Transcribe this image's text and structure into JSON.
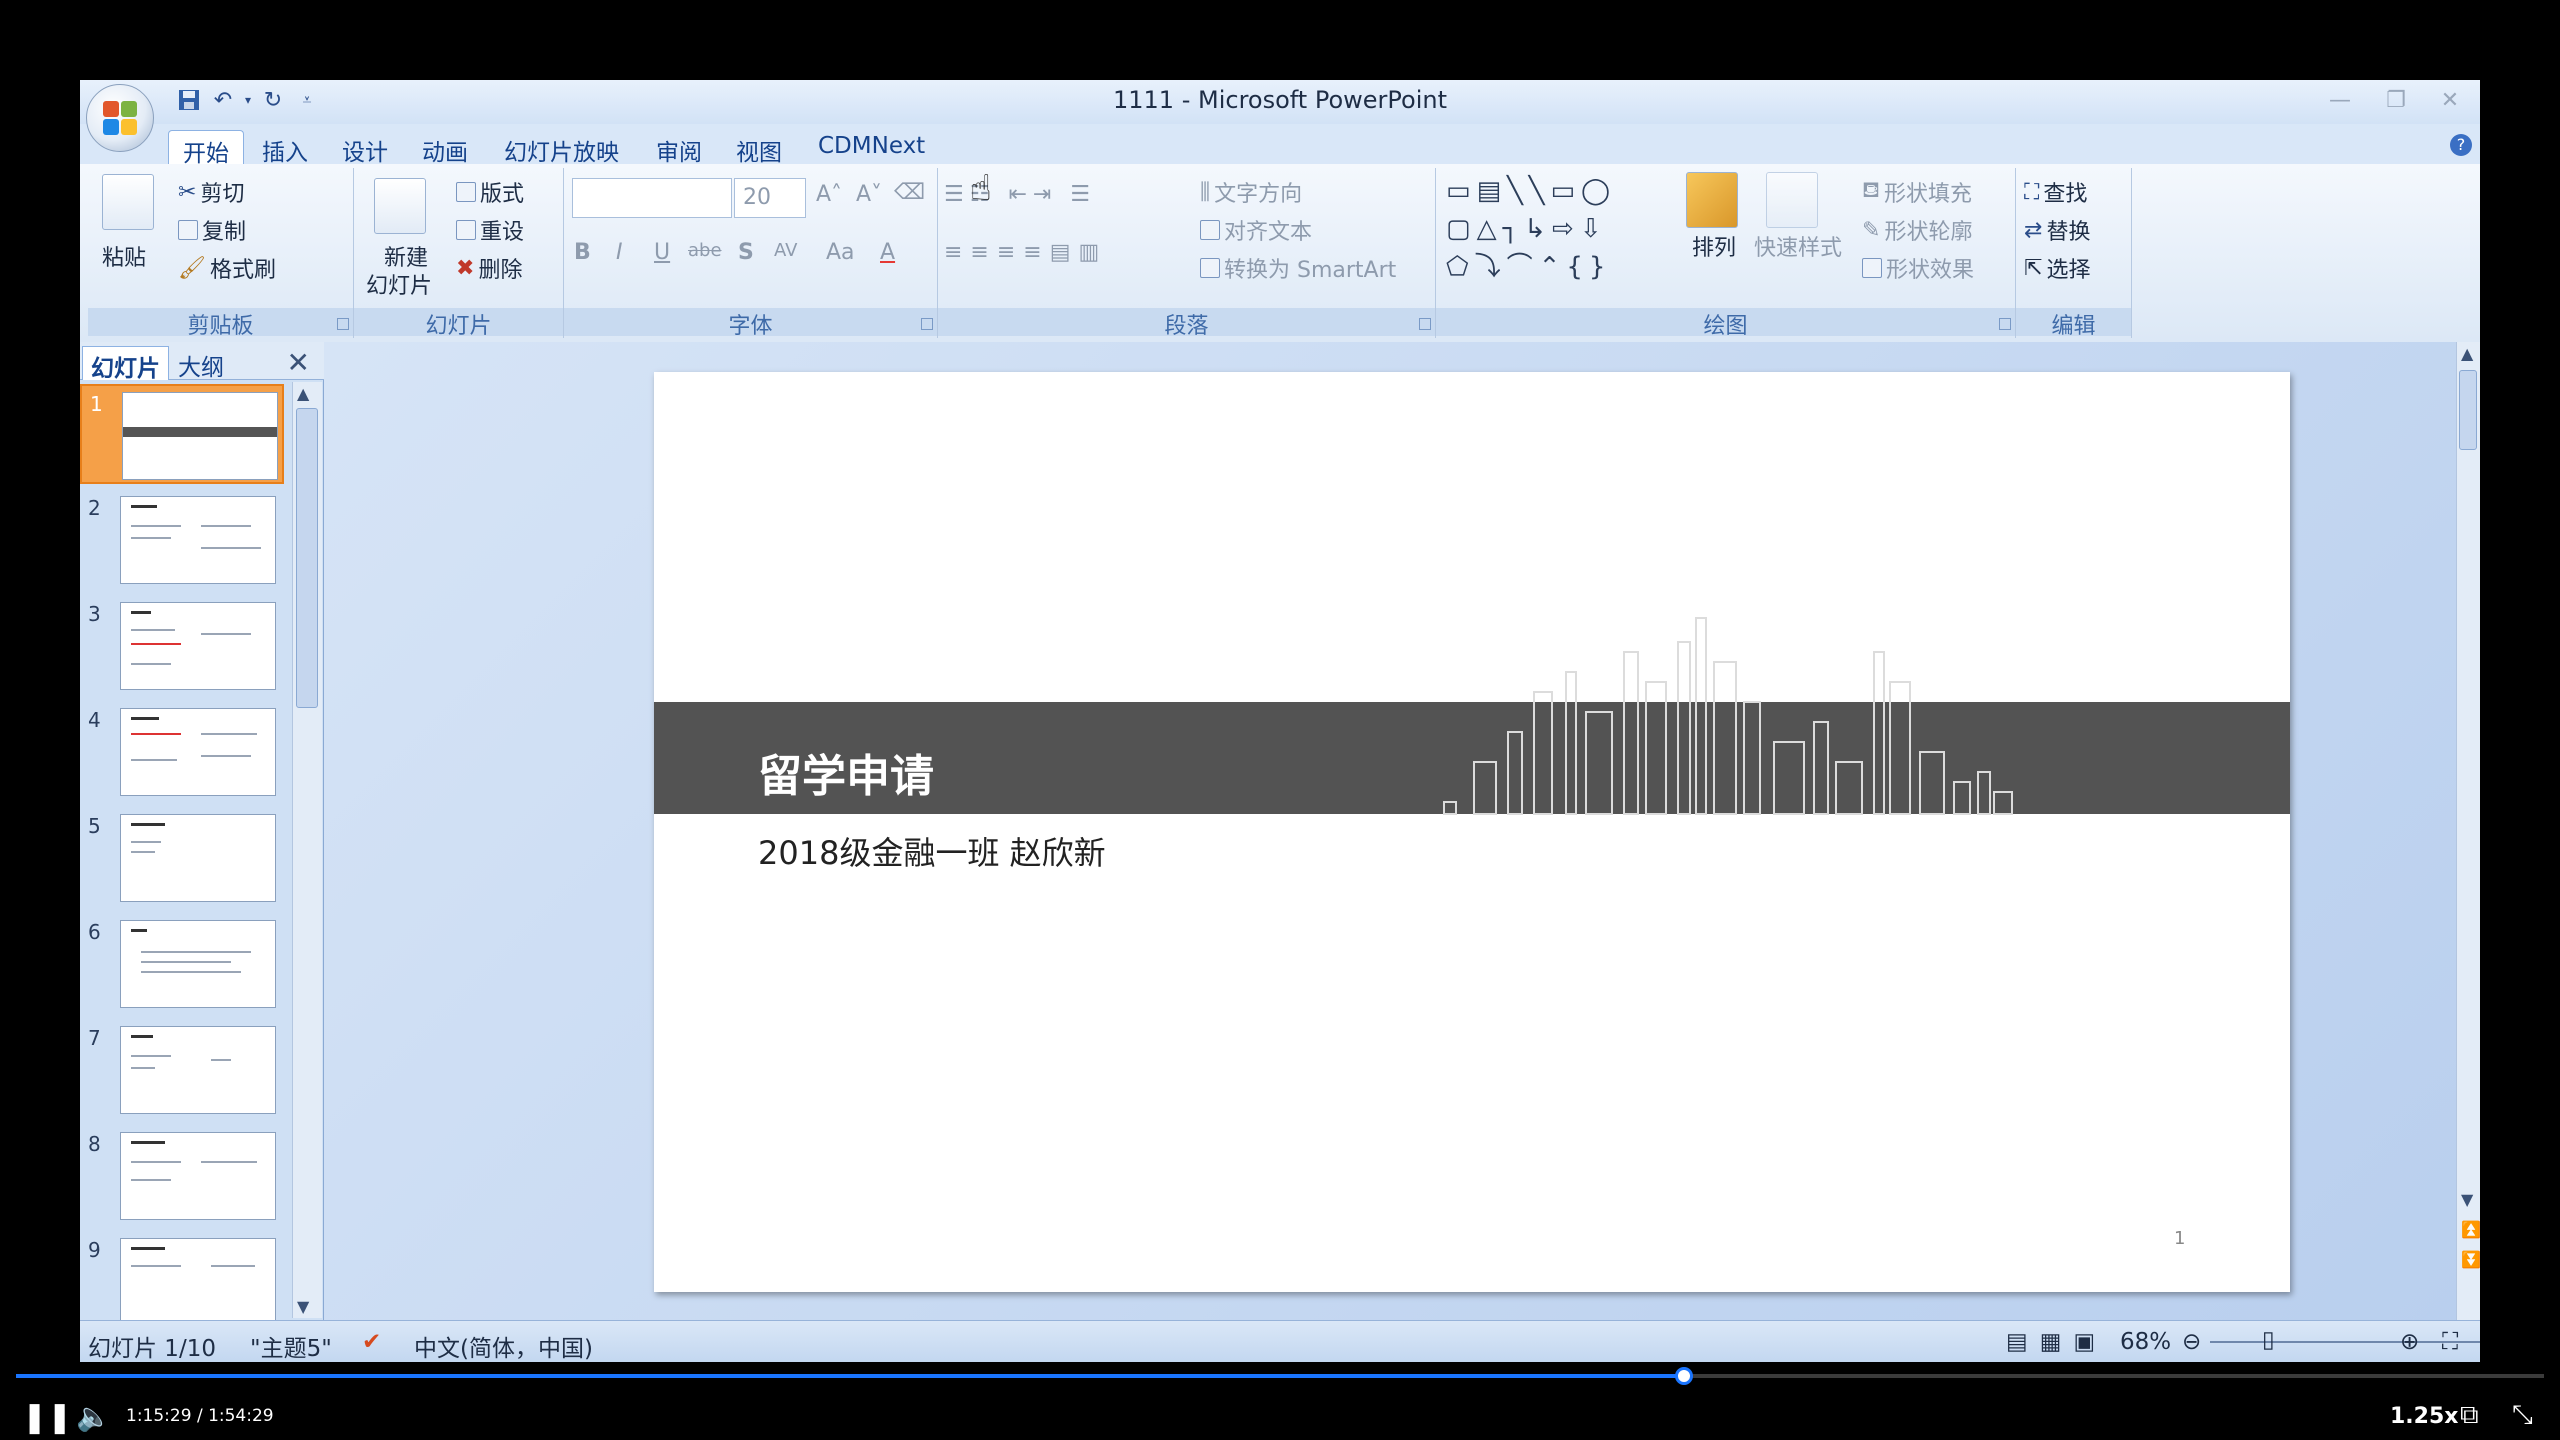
{
  "window": {
    "title": "1111 - Microsoft PowerPoint"
  },
  "tabs": [
    {
      "label": "开始",
      "active": true
    },
    {
      "label": "插入"
    },
    {
      "label": "设计"
    },
    {
      "label": "动画"
    },
    {
      "label": "幻灯片放映"
    },
    {
      "label": "审阅"
    },
    {
      "label": "视图"
    },
    {
      "label": "CDMNext"
    }
  ],
  "ribbon": {
    "clipboard": {
      "label": "剪贴板",
      "paste": "粘贴",
      "cut": "剪切",
      "copy": "复制",
      "format_painter": "格式刷"
    },
    "slides": {
      "label": "幻灯片",
      "new_slide_line1": "新建",
      "new_slide_line2": "幻灯片",
      "layout": "版式",
      "reset": "重设",
      "delete": "删除"
    },
    "font": {
      "label": "字体",
      "font_name": "",
      "font_size": "20",
      "bold": "B",
      "italic": "I",
      "underline": "U",
      "strike": "abe",
      "shadow": "S",
      "spacing": "AV",
      "case": "Aa",
      "color": "A"
    },
    "paragraph": {
      "label": "段落",
      "text_direction": "文字方向",
      "align_text": "对齐文本",
      "convert_smartart": "转换为 SmartArt"
    },
    "drawing": {
      "label": "绘图",
      "arrange": "排列",
      "quick_styles": "快速样式",
      "shape_fill": "形状填充",
      "shape_outline": "形状轮廓",
      "shape_effects": "形状效果"
    },
    "editing": {
      "label": "编辑",
      "find": "查找",
      "replace": "替换",
      "select": "选择"
    }
  },
  "left_panel": {
    "tabs": [
      "幻灯片",
      "大纲"
    ],
    "thumbnails": [
      "1",
      "2",
      "3",
      "4",
      "5",
      "6",
      "7",
      "8",
      "9"
    ],
    "selected": "1"
  },
  "slide": {
    "title": "留学申请",
    "subtitle": "2018级金融一班 赵欣新",
    "page_number": "1"
  },
  "status": {
    "slide_info": "幻灯片 1/10",
    "theme": "\"主题5\"",
    "language": "中文(简体，中国)",
    "zoom": "68%"
  },
  "video": {
    "time": "1:15:29 / 1:54:29",
    "speed": "1.25x",
    "progress": 0.66
  }
}
